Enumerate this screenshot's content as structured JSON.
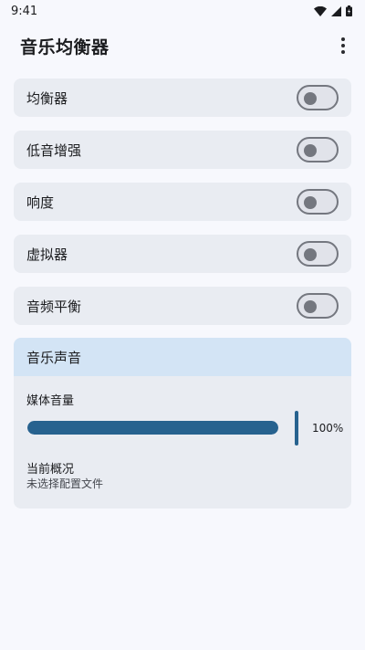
{
  "status_bar": {
    "time": "9:41",
    "icons": [
      "wifi-icon",
      "signal-icon",
      "battery-icon"
    ]
  },
  "app_bar": {
    "title": "音乐均衡器",
    "menu_icon": "more-vert-icon"
  },
  "toggles": [
    {
      "id": "equalizer",
      "label": "均衡器",
      "on": false
    },
    {
      "id": "bass-boost",
      "label": "低音增强",
      "on": false
    },
    {
      "id": "loudness",
      "label": "响度",
      "on": false
    },
    {
      "id": "virtualizer",
      "label": "虚拟器",
      "on": false
    },
    {
      "id": "balance",
      "label": "音频平衡",
      "on": false
    }
  ],
  "music_sound": {
    "title": "音乐声音",
    "volume_label": "媒体音量",
    "volume_level": 1.0,
    "volume_text": "100%",
    "profile_title": "当前概况",
    "profile_value": "未选择配置文件"
  },
  "colors": {
    "background": "#f7f8fd",
    "card": "#e9ecf2",
    "card_header": "#d3e4f5",
    "accent": "#27628f",
    "switch_outline": "#74777f"
  }
}
